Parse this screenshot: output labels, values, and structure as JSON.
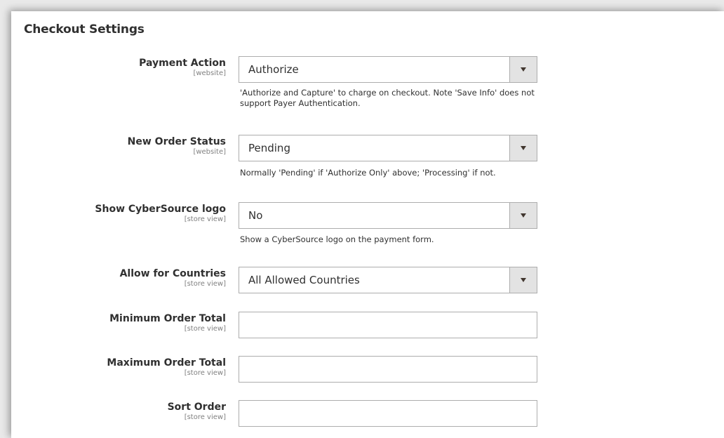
{
  "section": {
    "title": "Checkout Settings"
  },
  "fields": [
    {
      "label": "Payment Action",
      "scope": "[website]",
      "type": "select",
      "value": "Authorize",
      "note": "'Authorize and Capture' to charge on checkout. Note 'Save Info' does not support Payer Authentication."
    },
    {
      "label": "New Order Status",
      "scope": "[website]",
      "type": "select",
      "value": "Pending",
      "note": "Normally 'Pending' if 'Authorize Only' above; 'Processing' if not."
    },
    {
      "label": "Show CyberSource logo",
      "scope": "[store view]",
      "type": "select",
      "value": "No",
      "note": "Show a CyberSource logo on the payment form."
    },
    {
      "label": "Allow for Countries",
      "scope": "[store view]",
      "type": "select",
      "value": "All Allowed Countries"
    },
    {
      "label": "Minimum Order Total",
      "scope": "[store view]",
      "type": "text",
      "value": ""
    },
    {
      "label": "Maximum Order Total",
      "scope": "[store view]",
      "type": "text",
      "value": ""
    },
    {
      "label": "Sort Order",
      "scope": "[store view]",
      "type": "text",
      "value": ""
    }
  ],
  "icons": {
    "select_arrow": "triangle-down-icon"
  },
  "colors": {
    "border": "#adadad",
    "arrow_bg": "#e3e3e3",
    "text": "#303030"
  }
}
